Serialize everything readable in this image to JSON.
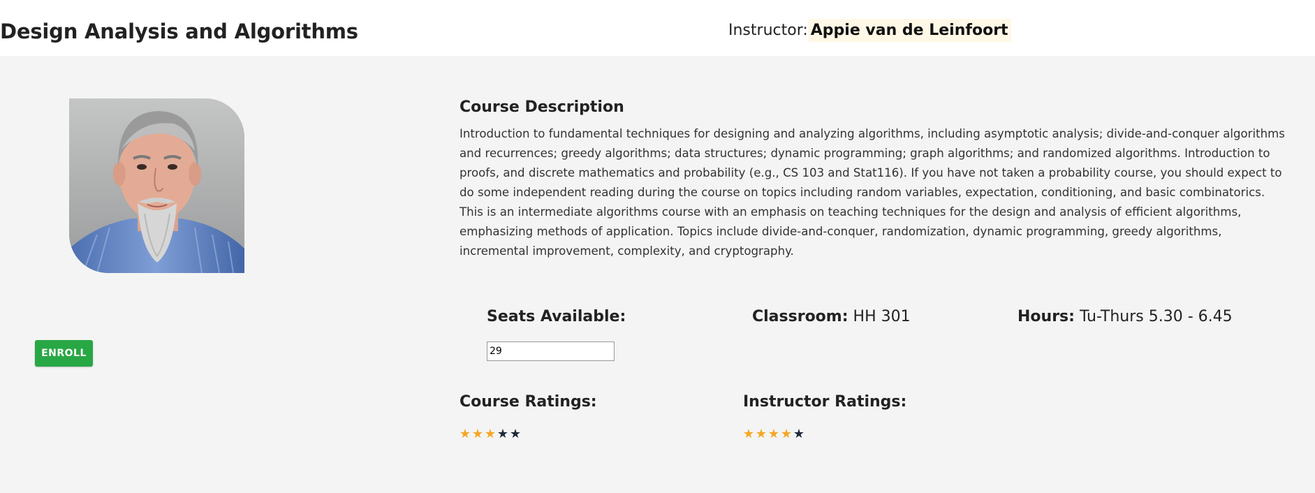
{
  "header": {
    "course_title": "Design Analysis and Algorithms",
    "instructor_label": "Instructor:",
    "instructor_name": "Appie van de Leinfoort"
  },
  "actions": {
    "enroll_label": "ENROLL"
  },
  "description": {
    "heading": "Course Description",
    "text": "Introduction to fundamental techniques for designing and analyzing algorithms, including asymptotic analysis; divide-and-conquer algorithms and recurrences; greedy algorithms; data structures; dynamic programming; graph algorithms; and randomized algorithms. Introduction to proofs, and discrete mathematics and probability (e.g., CS 103 and Stat116). If you have not taken a probability course, you should expect to do some independent reading during the course on topics including random variables, expectation, conditioning, and basic combinatorics. This is an intermediate algorithms course with an emphasis on teaching techniques for the design and analysis of efficient algorithms, emphasizing methods of application. Topics include divide-and-conquer, randomization, dynamic programming, greedy algorithms, incremental improvement, complexity, and cryptography."
  },
  "info": {
    "seats_label": "Seats Available:",
    "seats_value": "29",
    "classroom_label": "Classroom:",
    "classroom_value": "HH 301",
    "hours_label": "Hours:",
    "hours_value": "Tu-Thurs 5.30 - 6.45"
  },
  "ratings": {
    "course_label": "Course Ratings:",
    "course_value": 3,
    "instructor_label": "Instructor Ratings:",
    "instructor_value": 4,
    "max": 5,
    "star_glyph": "★"
  },
  "colors": {
    "enroll_button": "#28a745",
    "star_filled": "#f5a623",
    "star_empty": "#1e2a3a",
    "instructor_highlight": "#fff8e6",
    "page_background": "#f4f4f4"
  },
  "icons": {
    "rating_star": "star-icon",
    "instructor_photo": "instructor-avatar"
  }
}
